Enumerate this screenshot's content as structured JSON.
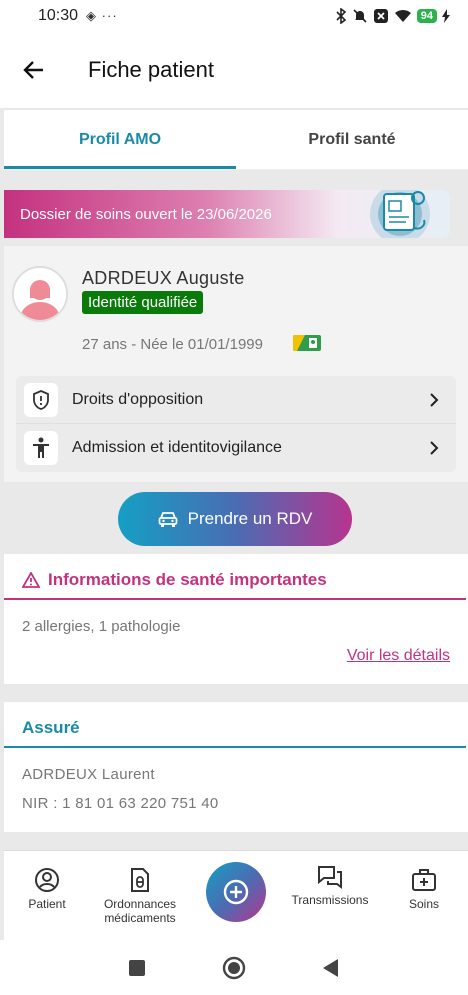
{
  "status_bar": {
    "time": "10:30",
    "extra_icons": "◈ ···",
    "battery": "94"
  },
  "header": {
    "title": "Fiche patient"
  },
  "tabs": [
    {
      "label": "Profil AMO",
      "active": true
    },
    {
      "label": "Profil santé",
      "active": false
    }
  ],
  "banner": {
    "text": "Dossier de soins ouvert le 23/06/2026"
  },
  "patient": {
    "name": "ADRDEUX Auguste",
    "badge": "Identité qualifiée",
    "age_birth": "27 ans - Née le 01/01/1999"
  },
  "menu": [
    {
      "label": "Droits d'opposition",
      "icon": "shield-alert-icon"
    },
    {
      "label": "Admission et identitovigilance",
      "icon": "person-icon"
    }
  ],
  "rdv_button": {
    "label": "Prendre un RDV"
  },
  "health_info": {
    "title": "Informations de santé importantes",
    "summary": "2 allergies, 1 pathologie",
    "link": "Voir les détails"
  },
  "insured": {
    "title": "Assuré",
    "name": "ADRDEUX Laurent",
    "nir": "NIR : 1 81 01 63 220 751 40"
  },
  "bottom_nav": [
    {
      "label": "Patient",
      "icon": "patient-icon"
    },
    {
      "label": "Ordonnances médicaments",
      "icon": "prescription-icon"
    },
    {
      "label": "Transmissions",
      "icon": "chat-icon"
    },
    {
      "label": "Soins",
      "icon": "medical-kit-icon"
    }
  ],
  "colors": {
    "primary": "#1b8aa6",
    "accent": "#c4327f",
    "badge_green": "#0a7a0a"
  }
}
